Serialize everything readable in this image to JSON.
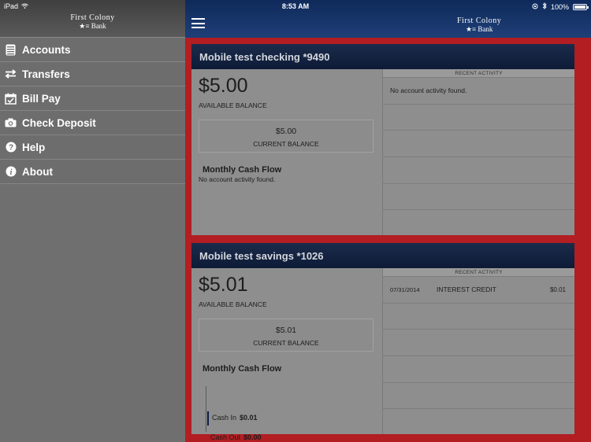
{
  "status_bar": {
    "device": "iPad",
    "time": "8:53 AM",
    "battery": "100%"
  },
  "sidebar": {
    "logo_line1": "First Colony",
    "logo_line2": "Bank",
    "items": [
      {
        "label": "Accounts",
        "icon": "accounts-icon"
      },
      {
        "label": "Transfers",
        "icon": "transfers-icon"
      },
      {
        "label": "Bill Pay",
        "icon": "calendar-check-icon"
      },
      {
        "label": "Check Deposit",
        "icon": "camera-icon"
      },
      {
        "label": "Help",
        "icon": "help-icon"
      },
      {
        "label": "About",
        "icon": "info-icon"
      }
    ]
  },
  "header": {
    "logo_line1": "First Colony",
    "logo_line2": "Bank"
  },
  "accounts": [
    {
      "name": "Mobile test checking *9490",
      "available_balance": "$5.00",
      "available_label": "AVAILABLE BALANCE",
      "current_balance": "$5.00",
      "current_label": "CURRENT BALANCE",
      "cash_flow_title": "Monthly Cash Flow",
      "cash_flow_empty": "No account activity found.",
      "recent_activity_header": "RECENT ACTIVITY",
      "recent_activity_empty": "No account activity found."
    },
    {
      "name": "Mobile test savings *1026",
      "available_balance": "$5.01",
      "available_label": "AVAILABLE BALANCE",
      "current_balance": "$5.01",
      "current_label": "CURRENT BALANCE",
      "cash_flow_title": "Monthly Cash Flow",
      "cash_in_label": "Cash In",
      "cash_in_value": "$0.01",
      "cash_out_label": "Cash Out",
      "cash_out_value": "$0.00",
      "recent_activity_header": "RECENT ACTIVITY",
      "transactions": [
        {
          "date": "07/31/2014",
          "description": "INTEREST CREDIT",
          "amount": "$0.01"
        }
      ]
    }
  ],
  "colors": {
    "main_background": "#b21e22",
    "header_navy": "#0f2a5a",
    "sidebar_gray": "#6f6f6f"
  }
}
